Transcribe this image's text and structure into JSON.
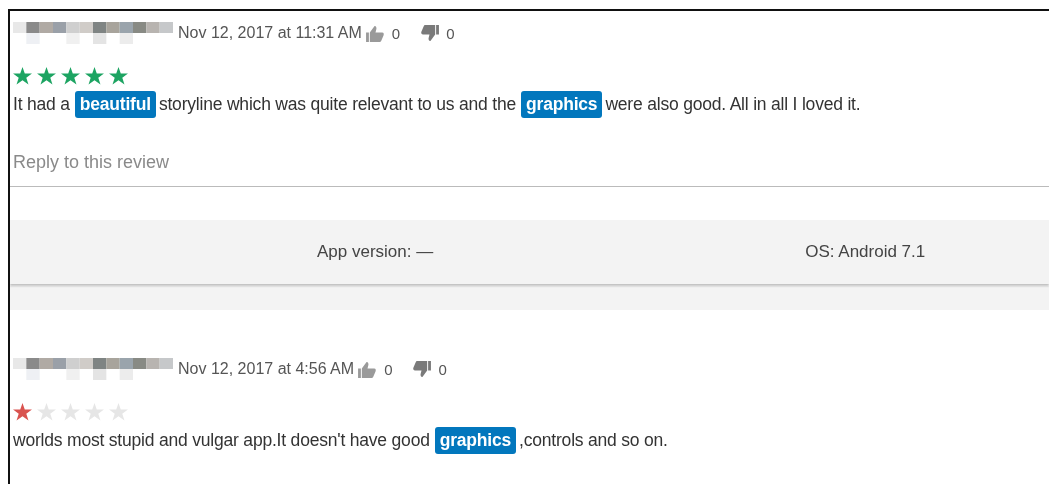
{
  "reviews": [
    {
      "date": "Nov 12, 2017 at 11:31 AM",
      "likes": "0",
      "dislikes": "0",
      "stars": 5,
      "color": "#1da462",
      "text": [
        {
          "text": "It had a",
          "highlighted": false
        },
        {
          "text": "beautiful",
          "highlighted": true
        },
        {
          "text": "storyline which was quite relevant to us and the",
          "highlighted": false
        },
        {
          "text": "graphics",
          "highlighted": true
        },
        {
          "text": "were also good. All in all I loved it.",
          "highlighted": false
        }
      ],
      "reply_link": "Reply to this review",
      "app_version": "App version: —",
      "os": "OS: Android 7.1"
    },
    {
      "date": "Nov 12, 2017 at 4:56 AM",
      "likes": "0",
      "dislikes": "0",
      "stars": 1,
      "color": "#d9534f",
      "text": [
        {
          "text": "worlds most stupid and vulgar app.It doesn't have good",
          "highlighted": false
        },
        {
          "text": "graphics",
          "highlighted": true
        },
        {
          "text": ",controls and so on.",
          "highlighted": false
        }
      ]
    }
  ]
}
